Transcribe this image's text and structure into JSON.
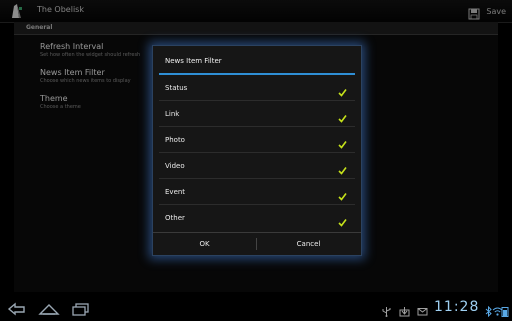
{
  "app": {
    "title": "The Obelisk"
  },
  "toolbar": {
    "save_label": "Save"
  },
  "preferences": {
    "category": "General",
    "items": [
      {
        "title": "Refresh Interval",
        "summary": "Set how often the widget should refresh"
      },
      {
        "title": "News Item Filter",
        "summary": "Choose which news items to display"
      },
      {
        "title": "Theme",
        "summary": "Choose a theme"
      }
    ]
  },
  "dialog": {
    "title": "News Item Filter",
    "options": [
      {
        "label": "Status",
        "checked": true
      },
      {
        "label": "Link",
        "checked": true
      },
      {
        "label": "Photo",
        "checked": true
      },
      {
        "label": "Video",
        "checked": true
      },
      {
        "label": "Event",
        "checked": true
      },
      {
        "label": "Other",
        "checked": true
      }
    ],
    "ok_label": "OK",
    "cancel_label": "Cancel"
  },
  "system_bar": {
    "time": "11:28",
    "icons": [
      "back-icon",
      "home-icon",
      "recent-apps-icon",
      "usb-icon",
      "download-icon",
      "email-icon",
      "battery-icon",
      "wifi-icon",
      "bluetooth-icon"
    ]
  },
  "colors": {
    "accent": "#2f8fd6",
    "check": "#c6e21a",
    "clock": "#9fd0f2"
  }
}
